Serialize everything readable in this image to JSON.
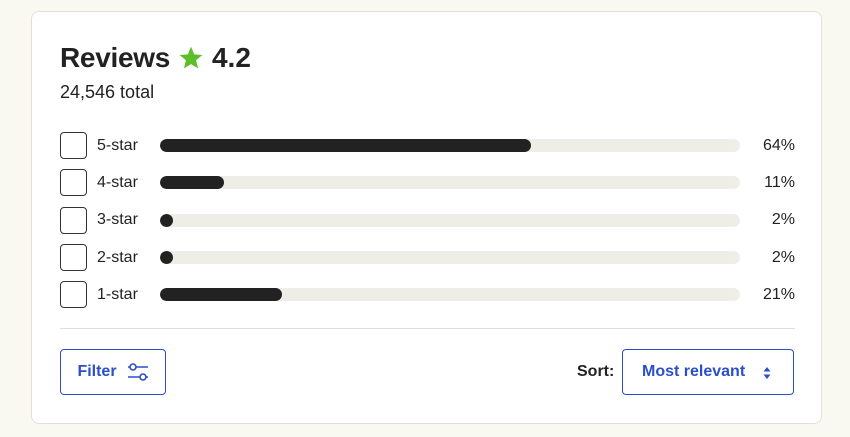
{
  "reviews": {
    "title": "Reviews",
    "rating": "4.2",
    "total": "24,546 total",
    "star_color": "#5cbf2a",
    "star_icon": "star-icon"
  },
  "breakdown": [
    {
      "label": "5-star",
      "percent": 64,
      "percent_label": "64%"
    },
    {
      "label": "4-star",
      "percent": 11,
      "percent_label": "11%"
    },
    {
      "label": "3-star",
      "percent": 2,
      "percent_label": "2%"
    },
    {
      "label": "2-star",
      "percent": 2,
      "percent_label": "2%"
    },
    {
      "label": "1-star",
      "percent": 21,
      "percent_label": "21%"
    }
  ],
  "controls": {
    "filter_label": "Filter",
    "filter_icon": "sliders-icon",
    "sort_label": "Sort:",
    "sort_value": "Most relevant",
    "sort_icon": "up-down-arrows-icon",
    "accent_color": "#2b4fc7"
  }
}
